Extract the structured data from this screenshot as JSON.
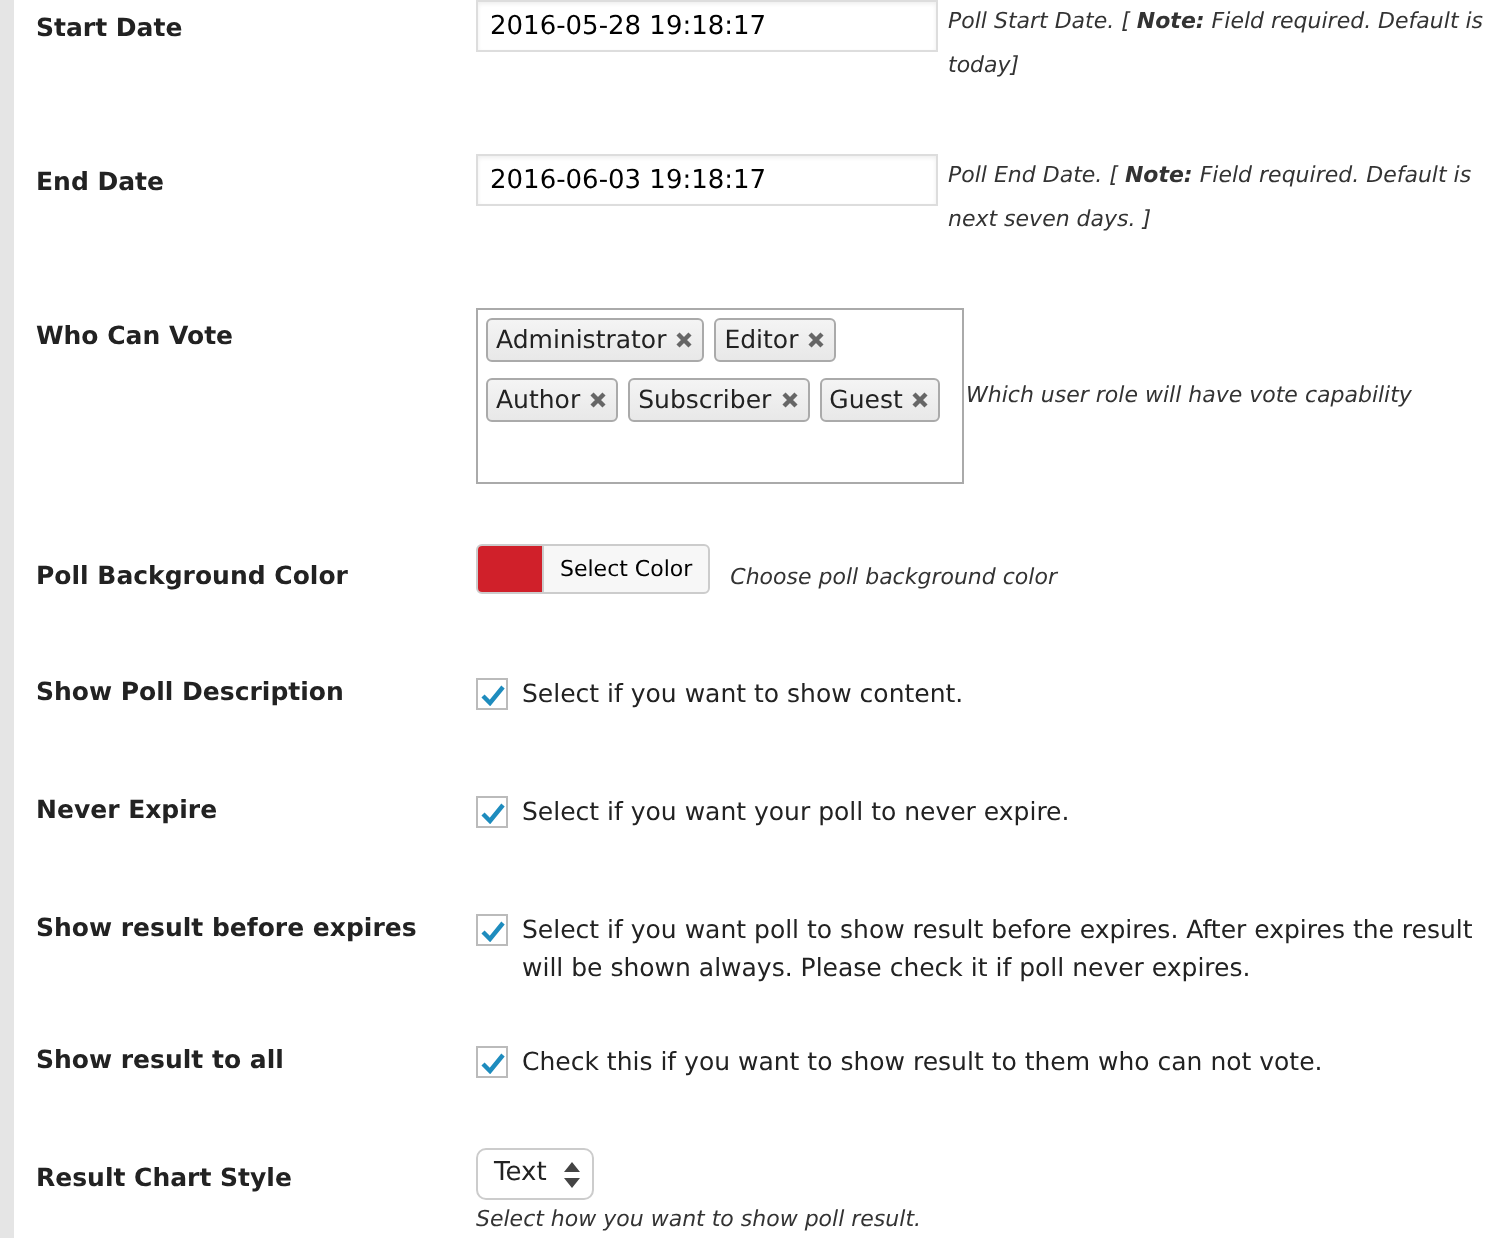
{
  "fields": [
    {
      "label": "Start Date",
      "kind": "text",
      "value": "2016-05-28 19:18:17",
      "help": "Poll Start Date. [ **Note:** Field required. Default is today]"
    },
    {
      "label": "End Date",
      "kind": "text",
      "value": "2016-06-03 19:18:17",
      "help": "Poll End Date. [ **Note:** Field required. Default is next seven days. ]"
    },
    {
      "label": "Who Can Vote",
      "kind": "tags",
      "tags": [
        "Administrator",
        "Editor",
        "Author",
        "Subscriber",
        "Guest"
      ],
      "help": "Which user role will have vote capability"
    },
    {
      "label": "Poll Background Color",
      "kind": "color",
      "color": "#d0202a",
      "button": "Select Color",
      "help": "Choose poll background color"
    },
    {
      "label": "Show Poll Description",
      "kind": "checkbox",
      "checked": true,
      "text": "Select if you want to show content."
    },
    {
      "label": "Never Expire",
      "kind": "checkbox",
      "checked": true,
      "text": "Select if you want your poll to never expire."
    },
    {
      "label": "Show result before expires",
      "kind": "checkbox",
      "checked": true,
      "text": "Select if you want poll to show result before expires. After expires the result will be shown always. Please check it if poll never expires."
    },
    {
      "label": "Show result to all",
      "kind": "checkbox",
      "checked": true,
      "text": "Check this if you want to show result to them who can not vote."
    },
    {
      "label": "Result Chart Style",
      "kind": "select",
      "value": "Text",
      "help": "Select how you want to show poll result."
    }
  ]
}
